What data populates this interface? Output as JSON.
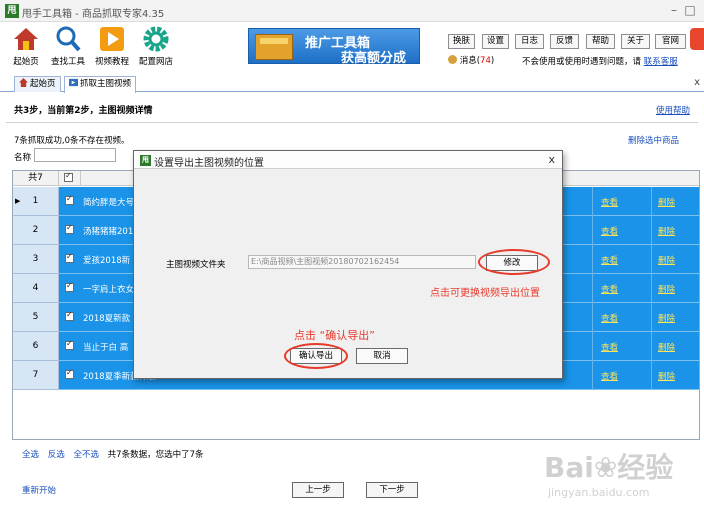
{
  "window": {
    "app_icon": "甩",
    "title": "甩手工具箱 - 商品抓取专家4.35",
    "controls": [
      "–",
      "□"
    ]
  },
  "toolbar": {
    "items": [
      {
        "label": "起始页",
        "icon": "home-icon"
      },
      {
        "label": "查找工具",
        "icon": "search-icon"
      },
      {
        "label": "视频教程",
        "icon": "play-icon"
      },
      {
        "label": "配置网店",
        "icon": "gear-icon"
      }
    ]
  },
  "promo": {
    "line1": "推广工具箱",
    "line2": "获高额分成"
  },
  "top_buttons": [
    "换肤",
    "设置",
    "日志",
    "反馈",
    "帮助",
    "关于",
    "官网"
  ],
  "messages": {
    "label": "消息(",
    "count": "74",
    "close": ")"
  },
  "notice": {
    "text": "不会使用或使用时遇到问题，请",
    "link": "联系客服"
  },
  "tabs": [
    {
      "label": "起始页"
    },
    {
      "label": "抓取主图视频"
    }
  ],
  "tab_close": "x",
  "step": {
    "text": "共3步，当前第2步，主图视频详情",
    "help": "使用帮助"
  },
  "result_text": "7条抓取成功,0条不存在视频。",
  "delete_selected": "删除选中商品",
  "name_label": "名称",
  "grid": {
    "header_count": "共7",
    "rows": [
      {
        "num": "1",
        "name": "简约胖是大号"
      },
      {
        "num": "2",
        "name": "汤猪猪猪201"
      },
      {
        "num": "3",
        "name": "爱孩2018新"
      },
      {
        "num": "4",
        "name": "一字肩上衣女"
      },
      {
        "num": "5",
        "name": "2018夏新款"
      },
      {
        "num": "6",
        "name": "当止于白 高"
      },
      {
        "num": "7",
        "name": "2018夏季新款韩版"
      }
    ],
    "view_label": "查看",
    "delete_label": "删除"
  },
  "bottom": {
    "select_all": "全选",
    "invert": "反选",
    "select_none": "全不选",
    "summary": "共7条数据，您选中了7条",
    "restart": "重新开始",
    "prev": "上一步",
    "next": "下一步"
  },
  "dialog": {
    "icon": "甩",
    "title": "设置导出主图视频的位置",
    "close": "x",
    "folder_label": "主图视频文件夹",
    "folder_value": "E:\\商品视频\\主图视频20180702162454",
    "change_button": "修改",
    "confirm_button": "确认导出",
    "cancel_button": "取消",
    "hint_change": "点击可更换视频导出位置",
    "hint_confirm": "点击 “确认导出”"
  },
  "watermark": {
    "text": "Bai❀经验",
    "sub": "jingyan.baidu.com"
  },
  "colors": {
    "row_blue": "#1a93e8",
    "link_yellow": "#ffe45c",
    "annotation_red": "#e83a2c",
    "link_blue": "#1a4fbd"
  }
}
